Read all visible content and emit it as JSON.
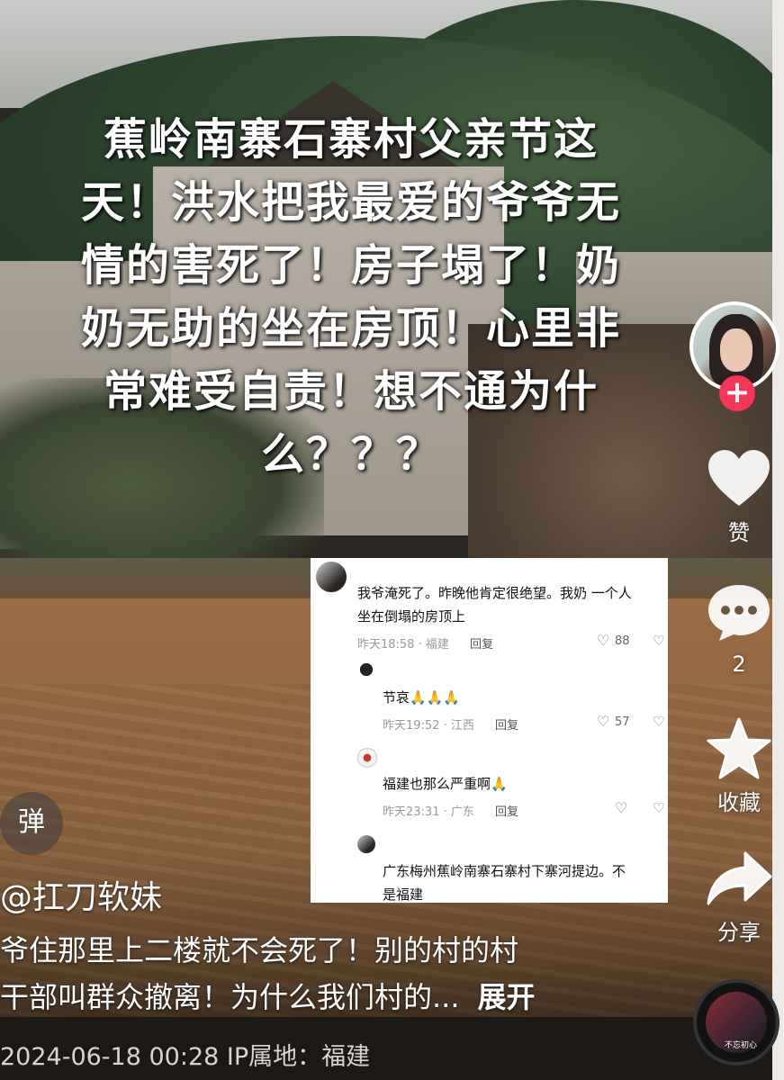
{
  "caption": {
    "lines": [
      "蕉岭南寨石寨村父亲节这",
      "天！洪水把我最爱的爷爷无",
      "情的害死了！房子塌了！奶",
      "奶无助的坐在房顶！心里非",
      "常难受自责！想不通为什",
      "么？？？"
    ]
  },
  "rail": {
    "follow_symbol": "+",
    "like_label": "赞",
    "comment_count": "2",
    "favorite_label": "收藏",
    "share_label": "分享",
    "disc_text": "不忘初心"
  },
  "danmaku_label": "弹",
  "author": "@扛刀软妹",
  "description": {
    "line1": "爷住那里上二楼就不会死了！别的村的村",
    "line2": "干部叫群众撤离！为什么我们村的...",
    "expand": "展开"
  },
  "meta": "2024-06-18 00:28  IP属地：福建",
  "comments": [
    {
      "text_line1": "我爷淹死了。昨晚他肯定很绝望。我奶 一个人",
      "text_line2": "坐在倒塌的房顶上",
      "time": "昨天18:58 · 福建",
      "reply": "回复",
      "likes": "88"
    },
    {
      "text": "节哀🙏🙏🙏",
      "time": "昨天19:52 · 江西",
      "reply": "回复",
      "likes": "57"
    },
    {
      "text": "福建也那么严重啊🙏",
      "time": "昨天23:31 · 广东",
      "reply": "回复",
      "likes": ""
    },
    {
      "text_line1": "广东梅州蕉岭南寨石寨村下寨河提边。不",
      "text_line2": "是福建"
    }
  ],
  "colors": {
    "accent": "#f43756",
    "caption_text": "#ffffff",
    "meta_text": "#d9d4cf"
  },
  "icons": [
    "heart-icon",
    "comment-icon",
    "star-icon",
    "share-icon",
    "plus-icon",
    "dislike-icon"
  ]
}
